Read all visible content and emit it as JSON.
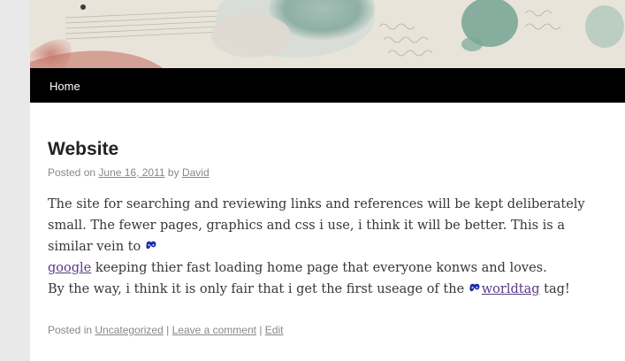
{
  "nav": {
    "home_label": "Home"
  },
  "post": {
    "title": "Website",
    "meta": {
      "posted_on_label": "Posted on",
      "date": "June 16, 2011",
      "by_label": "by",
      "author": "David"
    },
    "para1": {
      "text_a": "The site for searching and reviewing links and references will be kept deliberately small. The fewer pages, graphics and css i use, i think it will be better. This is a similar vein to ",
      "link_google": "google",
      "text_b": " keeping thier fast loading home page that everyone konws and loves."
    },
    "para2": {
      "text_a": "By the way, i think it is only fair that i get the first useage of the ",
      "link_worldtag": "worldtag",
      "text_b": " tag!"
    },
    "footer": {
      "posted_in_label": "Posted in",
      "category": "Uncategorized",
      "separator": "|",
      "comment_link": "Leave a comment",
      "edit_link": "Edit"
    }
  },
  "colors": {
    "nav_bg": "#000000",
    "link": "#5a3a86",
    "meta_text": "#888888",
    "body_text": "#373737",
    "icon_blue": "#2233cc"
  },
  "icons": [
    "swirl-icon"
  ]
}
